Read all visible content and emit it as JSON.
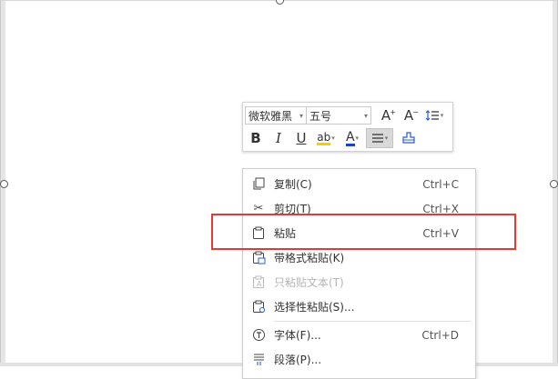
{
  "mini_toolbar": {
    "font_name": "微软雅黑",
    "font_size": "五号",
    "grow_font": "A",
    "shrink_font": "A",
    "bold": "B",
    "italic": "I",
    "underline": "U",
    "highlight": "ab",
    "font_color": "A",
    "colors": {
      "highlight": "#f0d000",
      "font": "#1a3fd1"
    }
  },
  "context_menu": {
    "items": [
      {
        "label": "复制(C)",
        "shortcut": "Ctrl+C",
        "icon": "copy-icon"
      },
      {
        "label": "剪切(T)",
        "shortcut": "Ctrl+X",
        "icon": "scissors-icon"
      },
      {
        "label": "粘贴",
        "shortcut": "Ctrl+V",
        "icon": "paste-icon"
      },
      {
        "label": "带格式粘贴(K)",
        "shortcut": "",
        "icon": "paste-format-icon"
      },
      {
        "label": "只粘贴文本(T)",
        "shortcut": "",
        "icon": "paste-text-icon",
        "disabled": true
      },
      {
        "label": "选择性粘贴(S)...",
        "shortcut": "",
        "icon": "paste-special-icon"
      },
      {
        "label": "字体(F)...",
        "shortcut": "Ctrl+D",
        "icon": "font-icon"
      },
      {
        "label": "段落(P)...",
        "shortcut": "",
        "icon": "paragraph-icon"
      }
    ]
  },
  "highlight_color": "#e53935"
}
